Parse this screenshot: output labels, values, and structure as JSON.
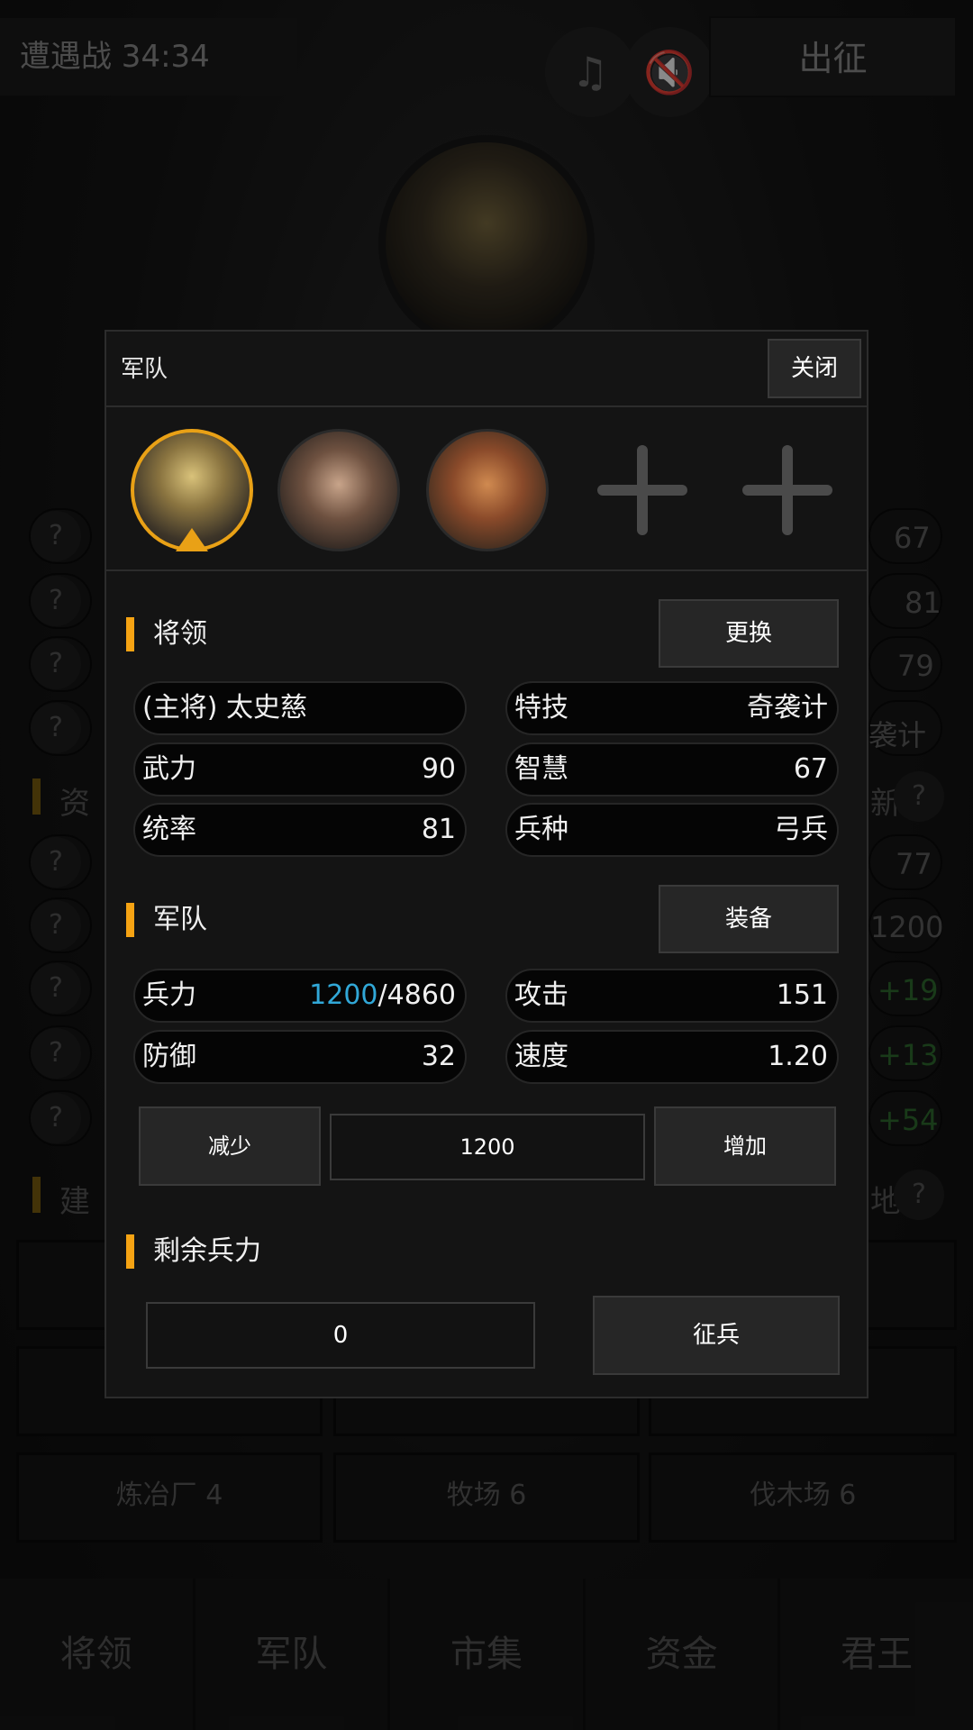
{
  "topbar": {
    "title": "遭遇战 34:34",
    "music_icon": "music-off-icon",
    "sound_icon": "sound-off-icon",
    "march_label": "出征"
  },
  "background": {
    "stats_right": [
      "67",
      "81",
      "79",
      "袭计"
    ],
    "section_resources_left": "资",
    "section_resources_right": "新",
    "resources_right": [
      "77",
      "1200",
      "+19",
      "+13",
      "+54"
    ],
    "section_buildings_left": "建",
    "section_buildings_right": "地",
    "buildings": [
      "炼冶厂 4",
      "牧场 6",
      "伐木场 6"
    ]
  },
  "nav": [
    "将领",
    "军队",
    "市集",
    "资金",
    "君王"
  ],
  "modal": {
    "title": "军队",
    "close_label": "关闭",
    "general_section": {
      "label": "将领",
      "button": "更换",
      "commander": "(主将) 太史慈",
      "stats": [
        {
          "label": "特技",
          "value": "奇袭计"
        },
        {
          "label": "武力",
          "value": "90"
        },
        {
          "label": "智慧",
          "value": "67"
        },
        {
          "label": "统率",
          "value": "81"
        },
        {
          "label": "兵种",
          "value": "弓兵"
        }
      ]
    },
    "army_section": {
      "label": "军队",
      "button": "装备",
      "troops_label": "兵力",
      "troops_current": "1200",
      "troops_max": "/4860",
      "stats": [
        {
          "label": "攻击",
          "value": "151"
        },
        {
          "label": "防御",
          "value": "32"
        },
        {
          "label": "速度",
          "value": "1.20"
        }
      ],
      "decrease_label": "减少",
      "quantity": "1200",
      "increase_label": "增加"
    },
    "remaining_section": {
      "label": "剩余兵力",
      "value": "0",
      "draft_label": "征兵"
    }
  }
}
